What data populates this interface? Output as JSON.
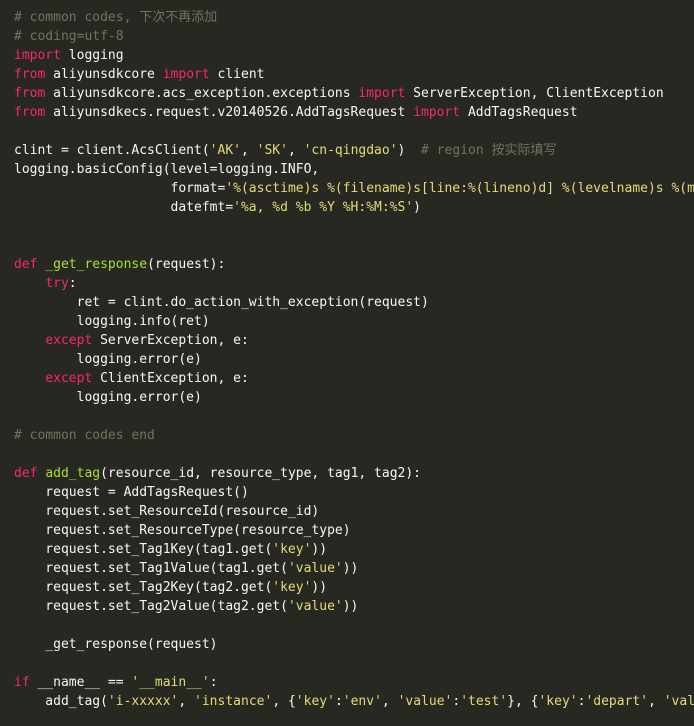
{
  "code": {
    "language": "python",
    "theme": {
      "background": "#272822",
      "plain": "#f8f8f2",
      "keyword": "#f92672",
      "string": "#e6db74",
      "comment": "#75715e",
      "function": "#a6e22e",
      "param": "#fd971f"
    },
    "lines": [
      [
        {
          "t": "comment",
          "v": "# common codes, 下次不再添加"
        }
      ],
      [
        {
          "t": "comment",
          "v": "# coding=utf-8"
        }
      ],
      [
        {
          "t": "keyword",
          "v": "import"
        },
        {
          "t": "plain",
          "v": " logging"
        }
      ],
      [
        {
          "t": "keyword",
          "v": "from"
        },
        {
          "t": "plain",
          "v": " aliyunsdkcore "
        },
        {
          "t": "keyword",
          "v": "import"
        },
        {
          "t": "plain",
          "v": " client"
        }
      ],
      [
        {
          "t": "keyword",
          "v": "from"
        },
        {
          "t": "plain",
          "v": " aliyunsdkcore.acs_exception.exceptions "
        },
        {
          "t": "keyword",
          "v": "import"
        },
        {
          "t": "plain",
          "v": " ServerException, ClientException"
        }
      ],
      [
        {
          "t": "keyword",
          "v": "from"
        },
        {
          "t": "plain",
          "v": " aliyunsdkecs.request.v20140526.AddTagsRequest "
        },
        {
          "t": "keyword",
          "v": "import"
        },
        {
          "t": "plain",
          "v": " AddTagsRequest"
        }
      ],
      [],
      [
        {
          "t": "plain",
          "v": "clint = client.AcsClient("
        },
        {
          "t": "string",
          "v": "'AK'"
        },
        {
          "t": "plain",
          "v": ", "
        },
        {
          "t": "string",
          "v": "'SK'"
        },
        {
          "t": "plain",
          "v": ", "
        },
        {
          "t": "string",
          "v": "'cn-qingdao'"
        },
        {
          "t": "plain",
          "v": ")  "
        },
        {
          "t": "comment",
          "v": "# region 按实际填写"
        }
      ],
      [
        {
          "t": "plain",
          "v": "logging.basicConfig(level=logging.INFO,"
        }
      ],
      [
        {
          "t": "plain",
          "v": "                    format="
        },
        {
          "t": "string",
          "v": "'%(asctime)s %(filename)s[line:%(lineno)d] %(levelname)s %(message)s'"
        },
        {
          "t": "plain",
          "v": ","
        }
      ],
      [
        {
          "t": "plain",
          "v": "                    datefmt="
        },
        {
          "t": "string",
          "v": "'%a, %d %b %Y %H:%M:%S'"
        },
        {
          "t": "plain",
          "v": ")"
        }
      ],
      [],
      [],
      [
        {
          "t": "keyword",
          "v": "def"
        },
        {
          "t": "plain",
          "v": " "
        },
        {
          "t": "func",
          "v": "_get_response"
        },
        {
          "t": "plain",
          "v": "(request):"
        }
      ],
      [
        {
          "t": "plain",
          "v": "    "
        },
        {
          "t": "keyword",
          "v": "try"
        },
        {
          "t": "plain",
          "v": ":"
        }
      ],
      [
        {
          "t": "plain",
          "v": "        ret = clint.do_action_with_exception(request)"
        }
      ],
      [
        {
          "t": "plain",
          "v": "        logging.info(ret)"
        }
      ],
      [
        {
          "t": "plain",
          "v": "    "
        },
        {
          "t": "keyword",
          "v": "except"
        },
        {
          "t": "plain",
          "v": " ServerException, e:"
        }
      ],
      [
        {
          "t": "plain",
          "v": "        logging.error(e)"
        }
      ],
      [
        {
          "t": "plain",
          "v": "    "
        },
        {
          "t": "keyword",
          "v": "except"
        },
        {
          "t": "plain",
          "v": " ClientException, e:"
        }
      ],
      [
        {
          "t": "plain",
          "v": "        logging.error(e)"
        }
      ],
      [],
      [
        {
          "t": "comment",
          "v": "# common codes end"
        }
      ],
      [],
      [
        {
          "t": "keyword",
          "v": "def"
        },
        {
          "t": "plain",
          "v": " "
        },
        {
          "t": "func",
          "v": "add_tag"
        },
        {
          "t": "plain",
          "v": "(resource_id, resource_type, tag1, tag2):"
        }
      ],
      [
        {
          "t": "plain",
          "v": "    request = AddTagsRequest()"
        }
      ],
      [
        {
          "t": "plain",
          "v": "    request.set_ResourceId(resource_id)"
        }
      ],
      [
        {
          "t": "plain",
          "v": "    request.set_ResourceType(resource_type)"
        }
      ],
      [
        {
          "t": "plain",
          "v": "    request.set_Tag1Key(tag1.get("
        },
        {
          "t": "string",
          "v": "'key'"
        },
        {
          "t": "plain",
          "v": "))"
        }
      ],
      [
        {
          "t": "plain",
          "v": "    request.set_Tag1Value(tag1.get("
        },
        {
          "t": "string",
          "v": "'value'"
        },
        {
          "t": "plain",
          "v": "))"
        }
      ],
      [
        {
          "t": "plain",
          "v": "    request.set_Tag2Key(tag2.get("
        },
        {
          "t": "string",
          "v": "'key'"
        },
        {
          "t": "plain",
          "v": "))"
        }
      ],
      [
        {
          "t": "plain",
          "v": "    request.set_Tag2Value(tag2.get("
        },
        {
          "t": "string",
          "v": "'value'"
        },
        {
          "t": "plain",
          "v": "))"
        }
      ],
      [],
      [
        {
          "t": "plain",
          "v": "    _get_response(request)"
        }
      ],
      [],
      [
        {
          "t": "keyword",
          "v": "if"
        },
        {
          "t": "plain",
          "v": " __name__ == "
        },
        {
          "t": "string",
          "v": "'__main__'"
        },
        {
          "t": "plain",
          "v": ":"
        }
      ],
      [
        {
          "t": "plain",
          "v": "    add_tag("
        },
        {
          "t": "string",
          "v": "'i-xxxxx'"
        },
        {
          "t": "plain",
          "v": ", "
        },
        {
          "t": "string",
          "v": "'instance'"
        },
        {
          "t": "plain",
          "v": ", {"
        },
        {
          "t": "string",
          "v": "'key'"
        },
        {
          "t": "plain",
          "v": ":"
        },
        {
          "t": "string",
          "v": "'env'"
        },
        {
          "t": "plain",
          "v": ", "
        },
        {
          "t": "string",
          "v": "'value'"
        },
        {
          "t": "plain",
          "v": ":"
        },
        {
          "t": "string",
          "v": "'test'"
        },
        {
          "t": "plain",
          "v": "}, {"
        },
        {
          "t": "string",
          "v": "'key'"
        },
        {
          "t": "plain",
          "v": ":"
        },
        {
          "t": "string",
          "v": "'depart'"
        },
        {
          "t": "plain",
          "v": ", "
        },
        {
          "t": "string",
          "v": "'value'"
        },
        {
          "t": "plain",
          "v": ":"
        }
      ]
    ]
  }
}
